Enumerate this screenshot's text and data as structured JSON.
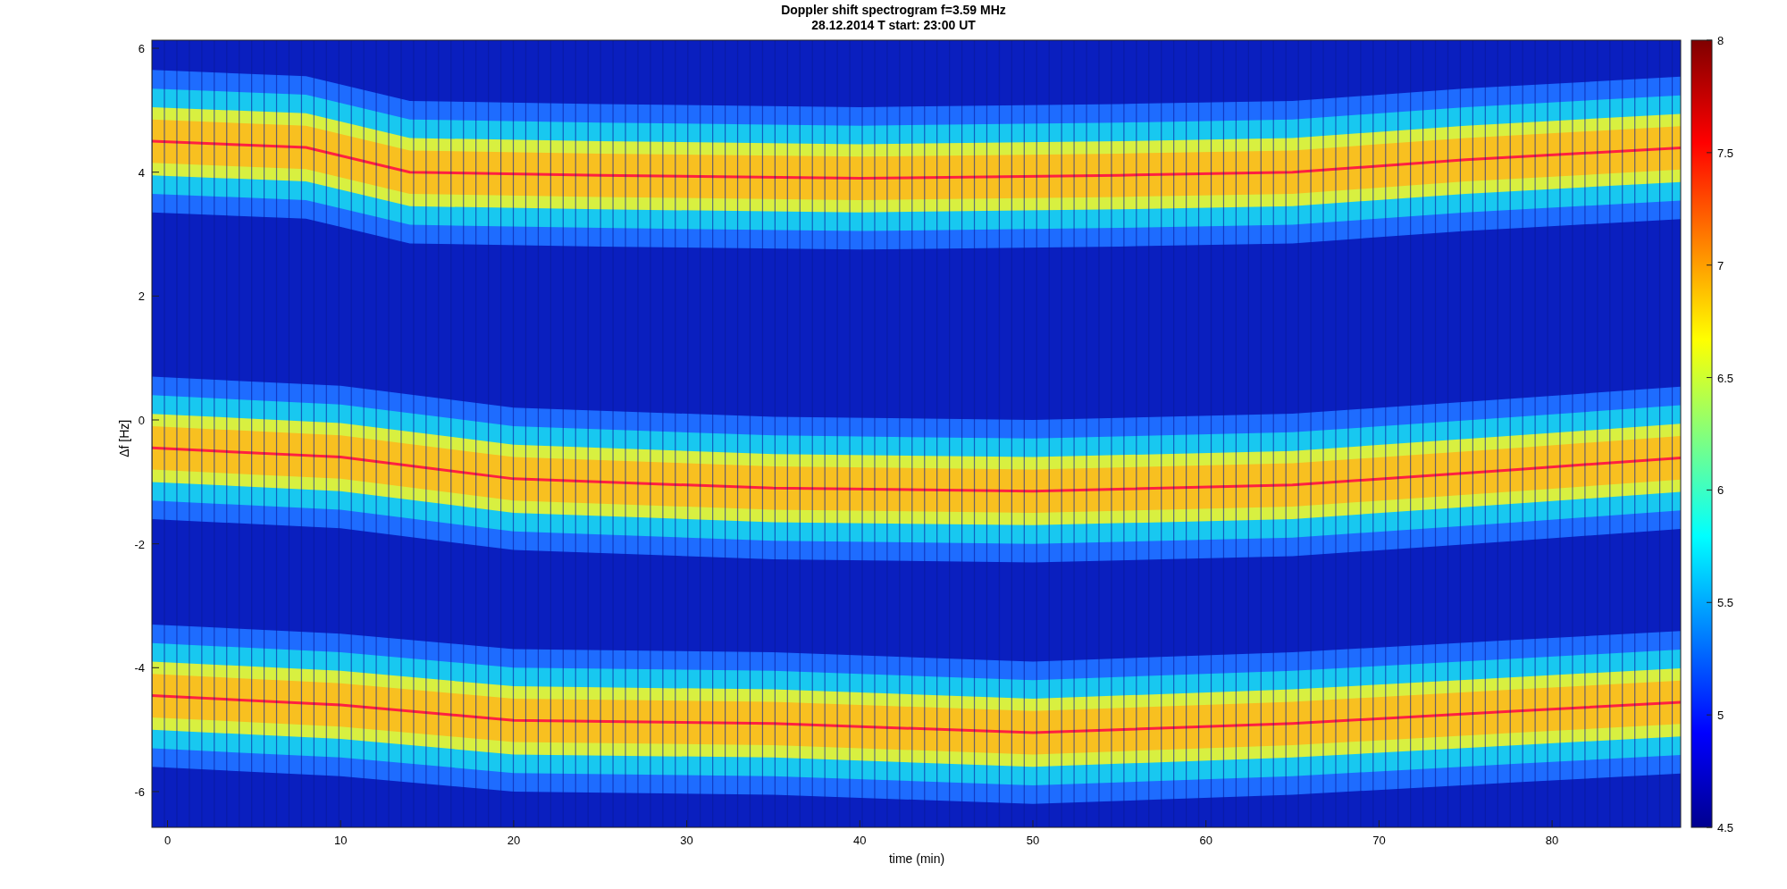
{
  "figure": {
    "title": "Doppler shift spectrogram f=3.59 MHz",
    "subtitle": "28.12.2014   T start: 23:00 UT"
  },
  "axes": {
    "xlabel": "time (min)",
    "ylabel": "Δf [Hz]",
    "xticks": [
      "0",
      "10",
      "20",
      "30",
      "40",
      "50",
      "60",
      "70",
      "80"
    ],
    "yticks": [
      "6",
      "4",
      "2",
      "0",
      "-2",
      "-4",
      "-6"
    ]
  },
  "colorbar": {
    "ticks": [
      "8",
      "7.5",
      "7",
      "6.5",
      "6",
      "5.5",
      "5",
      "4.5"
    ]
  }
}
